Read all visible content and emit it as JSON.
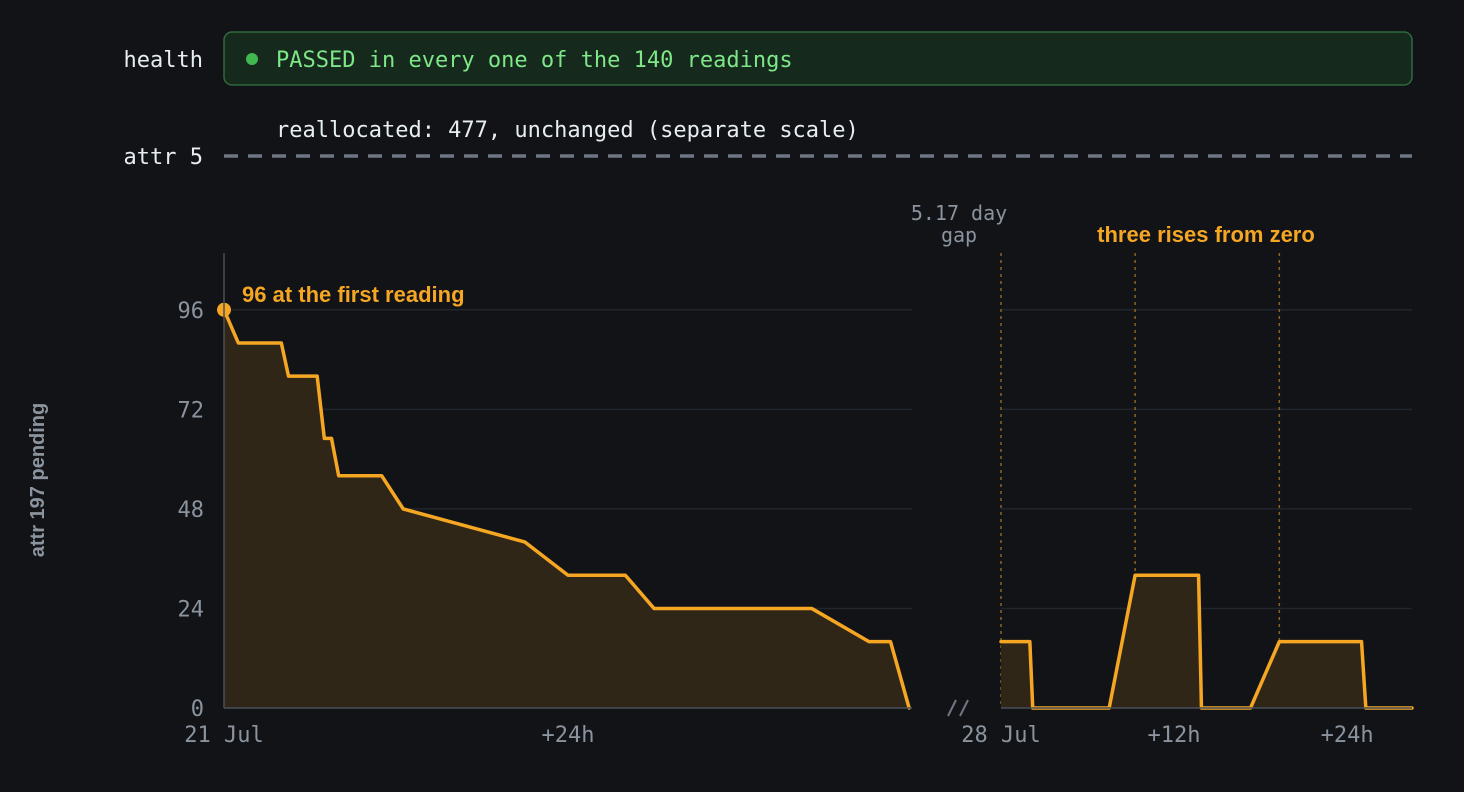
{
  "colors": {
    "background": "#111317",
    "accent": "#F5A623",
    "area_fill": "#302617",
    "pass_green": "#3FB950",
    "pass_text": "#7EE787",
    "pass_bg": "#15291C",
    "pass_border": "#2E6B3C",
    "text_primary": "#E6EDF3",
    "text_muted": "#8B949E",
    "grid": "#21262D",
    "dash_line": "#6E7681"
  },
  "health": {
    "label": "health",
    "status_text": "PASSED in every one of the 140 readings",
    "icon": "status-dot-icon"
  },
  "attr5": {
    "label": "attr 5",
    "note": "reallocated: 477, unchanged (separate scale)"
  },
  "gap_label": {
    "line1": "5.17 day",
    "line2": "gap"
  },
  "annotations": {
    "first_reading": "96 at the first reading",
    "rises": "three rises from zero"
  },
  "chart_data": {
    "type": "area",
    "ylabel": "attr 197 pending",
    "ylim": [
      0,
      108
    ],
    "y_ticks": [
      0,
      24,
      48,
      72,
      96
    ],
    "grid": true,
    "segments": [
      {
        "xlim_hours": [
          0,
          48
        ],
        "tick_values": [
          0,
          24
        ],
        "tick_labels": [
          "21 Jul",
          "+24h"
        ],
        "points": [
          [
            0,
            96
          ],
          [
            1,
            88
          ],
          [
            4,
            88
          ],
          [
            4.5,
            80
          ],
          [
            6.5,
            80
          ],
          [
            7,
            65
          ],
          [
            7.5,
            65
          ],
          [
            8,
            56
          ],
          [
            11,
            56
          ],
          [
            12.5,
            48
          ],
          [
            21,
            40
          ],
          [
            24,
            32
          ],
          [
            28,
            32
          ],
          [
            30,
            24
          ],
          [
            41,
            24
          ],
          [
            45,
            16
          ],
          [
            46.5,
            16
          ],
          [
            47.8,
            0
          ]
        ]
      },
      {
        "xlim_hours": [
          0,
          28.5
        ],
        "tick_values": [
          0,
          12,
          24
        ],
        "tick_labels": [
          "28 Jul",
          "+12h",
          "+24h"
        ],
        "points": [
          [
            0,
            16
          ],
          [
            2,
            16
          ],
          [
            2.2,
            0
          ],
          [
            7.5,
            0
          ],
          [
            9.3,
            32
          ],
          [
            13.7,
            32
          ],
          [
            13.9,
            0
          ],
          [
            17.3,
            0
          ],
          [
            19.3,
            16
          ],
          [
            25,
            16
          ],
          [
            25.3,
            0
          ],
          [
            28.5,
            0
          ]
        ],
        "rise_markers": [
          9.3,
          19.3
        ]
      }
    ]
  }
}
